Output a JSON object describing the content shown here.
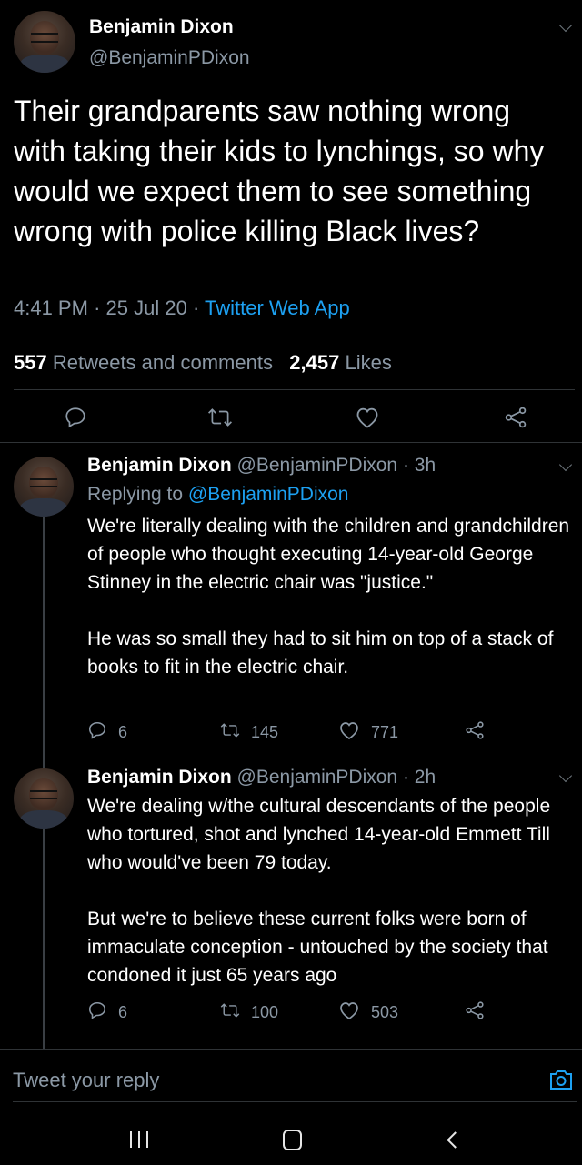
{
  "main_tweet": {
    "author_name": "Benjamin Dixon",
    "author_handle": "@BenjaminPDixon",
    "text": "Their grandparents saw nothing wrong with taking their kids to lynchings, so why would we expect them to see something wrong with police killing Black lives?",
    "time": "4:41 PM",
    "sep1": "·",
    "date": "25 Jul 20",
    "sep2": "·",
    "source": "Twitter Web App",
    "retweets_count": "557",
    "retweets_label": "Retweets and comments",
    "likes_count": "2,457",
    "likes_label": "Likes"
  },
  "replies": [
    {
      "author_name": "Benjamin Dixon",
      "author_handle": "@BenjaminPDixon",
      "sep": "·",
      "age": "3h",
      "replying_label": "Replying to",
      "replying_handle": "@BenjaminPDixon",
      "text": "We're literally dealing with the children and grandchildren of people who thought executing 14-year-old George Stinney in the electric chair was \"justice.\"\n\nHe was so small they had to sit him on top of a stack of books to fit in the electric chair.",
      "comments": "6",
      "retweets": "145",
      "likes": "771"
    },
    {
      "author_name": "Benjamin Dixon",
      "author_handle": "@BenjaminPDixon",
      "sep": "·",
      "age": "2h",
      "text": "We're dealing w/the cultural descendants of the people who tortured, shot and lynched 14-year-old Emmett Till who would've been 79 today.\n\nBut we're to believe these current folks were born of immaculate conception - untouched by the society that condoned it just 65 years ago",
      "comments": "6",
      "retweets": "100",
      "likes": "503"
    }
  ],
  "composer": {
    "placeholder": "Tweet your reply"
  },
  "icons": {
    "reply": "reply-icon",
    "retweet": "retweet-icon",
    "like": "heart-icon",
    "share": "share-icon",
    "camera": "camera-icon",
    "chevron": "chevron-down-icon"
  },
  "colors": {
    "background": "#000000",
    "accent": "#1da1f2",
    "secondary_text": "#8b98a5",
    "divider": "#2f3336"
  }
}
